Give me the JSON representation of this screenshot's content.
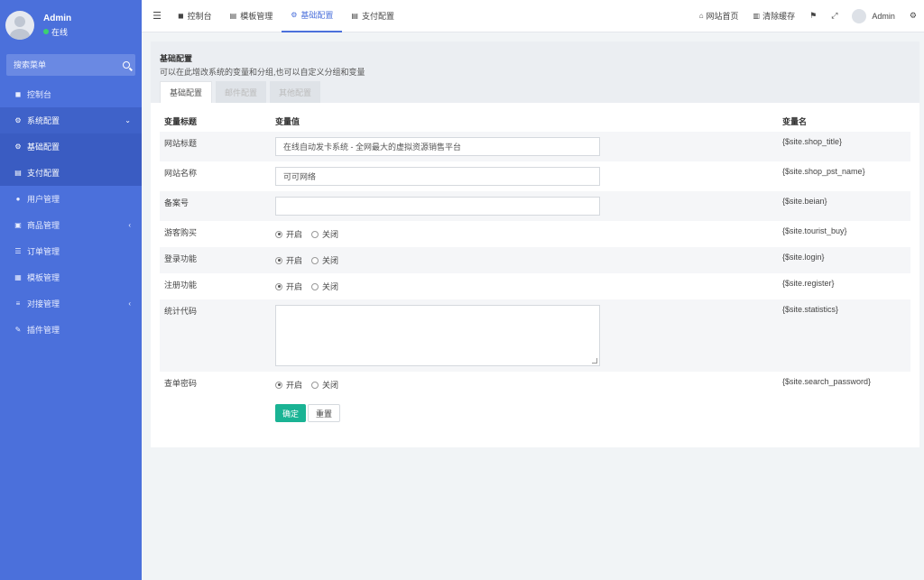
{
  "user": {
    "name": "Admin",
    "status": "在线"
  },
  "search": {
    "placeholder": "搜索菜单"
  },
  "menu": [
    {
      "icon": "dashboard-icon",
      "glyph": "◼",
      "label": "控制台"
    },
    {
      "icon": "gear-icon",
      "glyph": "⚙",
      "label": "系统配置",
      "arrow": "⌄"
    },
    {
      "icon": "gear-icon",
      "glyph": "⚙",
      "label": "基础配置"
    },
    {
      "icon": "card-icon",
      "glyph": "▤",
      "label": "支付配置"
    },
    {
      "icon": "user-icon",
      "glyph": "●",
      "label": "用户管理"
    },
    {
      "icon": "cart-icon",
      "glyph": "▣",
      "label": "商品管理",
      "arrow": "‹"
    },
    {
      "icon": "list-icon",
      "glyph": "☰",
      "label": "订单管理"
    },
    {
      "icon": "template-icon",
      "glyph": "▦",
      "label": "模板管理"
    },
    {
      "icon": "sliders-icon",
      "glyph": "≡",
      "label": "对接管理",
      "arrow": "‹"
    },
    {
      "icon": "plugin-icon",
      "glyph": "✎",
      "label": "插件管理"
    }
  ],
  "topbar": {
    "tabs": [
      {
        "glyph": "◼",
        "label": "控制台"
      },
      {
        "glyph": "▤",
        "label": "模板管理"
      },
      {
        "glyph": "⚙",
        "label": "基础配置"
      },
      {
        "glyph": "▤",
        "label": "支付配置"
      }
    ],
    "links": [
      {
        "glyph": "⌂",
        "label": "网站首页"
      },
      {
        "glyph": "▥",
        "label": "清除缓存"
      }
    ],
    "extra_icons": [
      "⚑",
      "⤢"
    ],
    "user": "Admin",
    "settings_glyph": "⚙"
  },
  "page": {
    "title": "基础配置",
    "description": "可以在此增改系统的变量和分组,也可以自定义分组和变量",
    "tabs": [
      "基础配置",
      "邮件配置",
      "其他配置"
    ]
  },
  "table": {
    "headers": [
      "变量标题",
      "变量值",
      "变量名"
    ],
    "rows": [
      {
        "label": "网站标题",
        "type": "text",
        "value": "在线自动发卡系统 - 全网最大的虚拟资源销售平台",
        "var": "{$site.shop_title}"
      },
      {
        "label": "网站名称",
        "type": "text",
        "value": "可可网络",
        "var": "{$site.shop_pst_name}"
      },
      {
        "label": "备案号",
        "type": "text",
        "value": "",
        "var": "{$site.beian}"
      },
      {
        "label": "游客购买",
        "type": "radio",
        "on": "开启",
        "off": "关闭",
        "var": "{$site.tourist_buy}"
      },
      {
        "label": "登录功能",
        "type": "radio",
        "on": "开启",
        "off": "关闭",
        "var": "{$site.login}"
      },
      {
        "label": "注册功能",
        "type": "radio",
        "on": "开启",
        "off": "关闭",
        "var": "{$site.register}"
      },
      {
        "label": "统计代码",
        "type": "textarea",
        "value": "",
        "var": "{$site.statistics}"
      },
      {
        "label": "查单密码",
        "type": "radio",
        "on": "开启",
        "off": "关闭",
        "var": "{$site.search_password}"
      }
    ]
  },
  "buttons": {
    "submit": "确定",
    "reset": "重置"
  },
  "colors": {
    "sidebar": "#4b70db",
    "primary": "#1ab394",
    "accent": "#4b70db"
  }
}
